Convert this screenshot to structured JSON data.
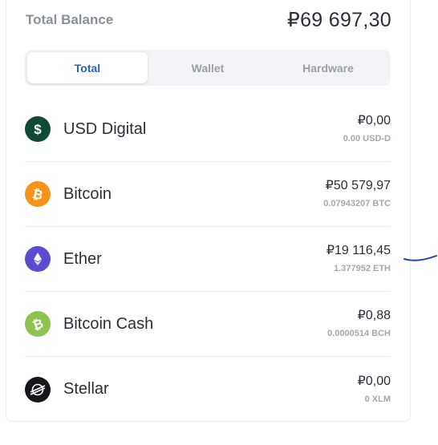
{
  "balance": {
    "label": "Total Balance",
    "value": "₽69 697,30"
  },
  "tabs": [
    {
      "label": "Total",
      "active": true
    },
    {
      "label": "Wallet",
      "active": false
    },
    {
      "label": "Hardware",
      "active": false
    }
  ],
  "assets": [
    {
      "name": "USD Digital",
      "fiat": "₽0,00",
      "crypto": "0.00 USD-D",
      "icon": "usd-digital-icon",
      "color": "#0e4a35"
    },
    {
      "name": "Bitcoin",
      "fiat": "₽50 579,97",
      "crypto": "0.07943207 BTC",
      "icon": "bitcoin-icon",
      "color": "#f7931a"
    },
    {
      "name": "Ether",
      "fiat": "₽19 116,45",
      "crypto": "1.377952 ETH",
      "icon": "ether-icon",
      "color": "#5b4bd1"
    },
    {
      "name": "Bitcoin Cash",
      "fiat": "₽0,88",
      "crypto": "0.0000514 BCH",
      "icon": "bitcoin-cash-icon",
      "color": "#8dc351"
    },
    {
      "name": "Stellar",
      "fiat": "₽0,00",
      "crypto": "0 XLM",
      "icon": "stellar-icon",
      "color": "#14171c"
    }
  ],
  "colors": {
    "accent": "#2962b3",
    "text": "#2b2f36",
    "muted": "#a3a8b0",
    "pen": "#1f3fb3"
  }
}
